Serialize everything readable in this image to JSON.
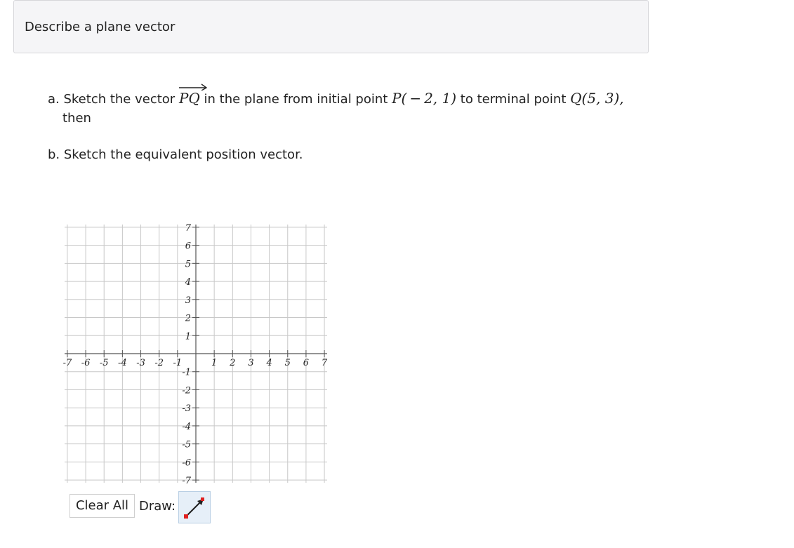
{
  "header": {
    "title": "Describe a plane vector"
  },
  "question": {
    "a_prefix": "a. Sketch the vector",
    "vector_name": "PQ",
    "a_mid1": "in the plane from initial point",
    "initial_point": "P( − 2, 1)",
    "a_mid2": "to terminal point",
    "terminal_point": "Q(5, 3),",
    "a_suffix": "then",
    "b_text": "b. Sketch the equivalent position vector."
  },
  "graph": {
    "x_ticks": [
      "-7",
      "-6",
      "-5",
      "-4",
      "-3",
      "-2",
      "-1",
      "1",
      "2",
      "3",
      "4",
      "5",
      "6",
      "7"
    ],
    "y_ticks": [
      "7",
      "6",
      "5",
      "4",
      "3",
      "2",
      "1",
      "-1",
      "-2",
      "-3",
      "-4",
      "-5",
      "-6",
      "-7"
    ],
    "xlim": [
      -7,
      7
    ],
    "ylim": [
      -7,
      7
    ],
    "grid": true,
    "grid_color": "#c8c8c8",
    "axis_color": "#555555"
  },
  "toolbar": {
    "clear_label": "Clear All",
    "draw_label": "Draw:",
    "draw_tool_icon": "vector-arrow-icon",
    "tool_accent": "#e6eff8"
  }
}
